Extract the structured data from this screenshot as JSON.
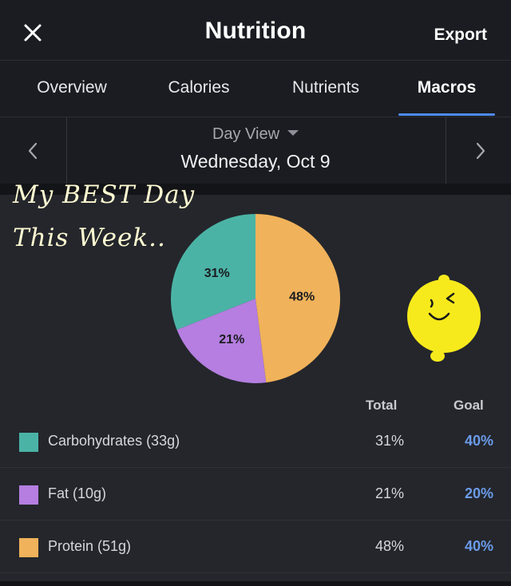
{
  "header": {
    "title": "Nutrition",
    "export_label": "Export"
  },
  "tabs": [
    {
      "label": "Overview",
      "active": false
    },
    {
      "label": "Calories",
      "active": false
    },
    {
      "label": "Nutrients",
      "active": false
    },
    {
      "label": "Macros",
      "active": true
    }
  ],
  "day_nav": {
    "view_label": "Day View",
    "date": "Wednesday, Oct 9"
  },
  "annotation": {
    "line1": "My BEST Day",
    "line2": "This Week.."
  },
  "chart_data": {
    "type": "pie",
    "slices": [
      {
        "label": "Carbohydrates",
        "value": 31,
        "display": "31%",
        "color": "#4bb3a6"
      },
      {
        "label": "Fat",
        "value": 21,
        "display": "21%",
        "color": "#b57ee0"
      },
      {
        "label": "Protein",
        "value": 48,
        "display": "48%",
        "color": "#f0b25a"
      }
    ]
  },
  "table": {
    "headers": {
      "total": "Total",
      "goal": "Goal"
    },
    "rows": [
      {
        "label": "Carbohydrates (33g)",
        "total": "31%",
        "goal": "40%",
        "color": "#4bb3a6"
      },
      {
        "label": "Fat (10g)",
        "total": "21%",
        "goal": "20%",
        "color": "#b57ee0"
      },
      {
        "label": "Protein (51g)",
        "total": "48%",
        "goal": "40%",
        "color": "#f0b25a"
      }
    ]
  },
  "colors": {
    "accent": "#4d8cf5",
    "goal_text": "#6b9be8",
    "sticker": "#f7ea1c"
  }
}
